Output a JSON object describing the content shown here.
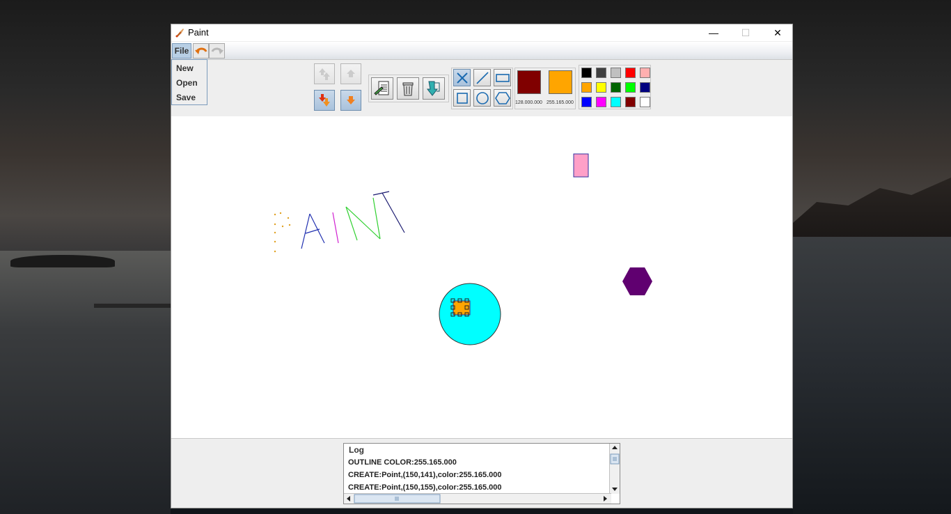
{
  "window": {
    "title": "Paint",
    "controls": {
      "minimize": "—",
      "maximize": "☐",
      "close": "✕"
    }
  },
  "menubar": {
    "file_label": "File",
    "undo_icon": "undo-icon",
    "redo_icon": "redo-icon"
  },
  "file_menu": {
    "items": [
      "New",
      "Open",
      "Save"
    ]
  },
  "toolbar": {
    "layer_buttons": [
      "move-to-front-icon",
      "move-forward-icon",
      "move-to-back-icon",
      "move-backward-icon"
    ],
    "edit_buttons": [
      "edit-note-icon",
      "trash-icon",
      "export-icon"
    ],
    "shape_buttons": [
      "cross-point-icon",
      "line-icon",
      "rectangle-icon",
      "square-icon",
      "circle-icon",
      "hexagon-icon"
    ],
    "outline_color": {
      "hex": "#800000",
      "label": "128.000.000"
    },
    "fill_color": {
      "hex": "#ffa500",
      "label": "255.165.000"
    },
    "palette": [
      "#000000",
      "#404040",
      "#c0c0c0",
      "#ff0000",
      "#ffafaf",
      "#ffa500",
      "#ffff00",
      "#006400",
      "#00ff00",
      "#000080",
      "#0000ff",
      "#ff00ff",
      "#00ffff",
      "#800000",
      "#ffffff"
    ]
  },
  "log": {
    "title": "Log",
    "lines": [
      "OUTLINE COLOR:255.165.000",
      "CREATE:Point,(150,141),color:255.165.000",
      "CREATE:Point,(150,155),color:255.165.000"
    ]
  }
}
